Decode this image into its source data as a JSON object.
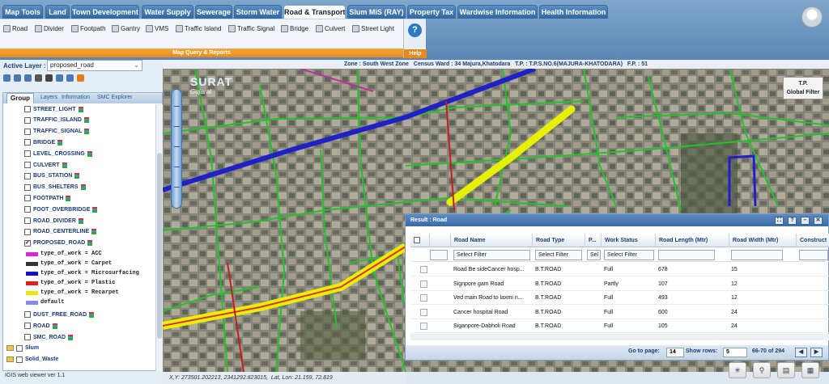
{
  "nav_tabs": [
    {
      "label": "Map Tools",
      "active": false
    },
    {
      "label": "Land",
      "active": false
    },
    {
      "label": "Town Development",
      "active": false
    },
    {
      "label": "Water Supply",
      "active": false
    },
    {
      "label": "Sewerage",
      "active": false
    },
    {
      "label": "Storm Water",
      "active": false
    },
    {
      "label": "Road & Transport",
      "active": true
    },
    {
      "label": "Slum MIS (RAY)",
      "active": false
    },
    {
      "label": "Property Tax",
      "active": false
    },
    {
      "label": "Wardwise Information",
      "active": false
    },
    {
      "label": "Health Information",
      "active": false
    }
  ],
  "ribbon": {
    "buttons": [
      {
        "label": "Road",
        "icon": "road-icon"
      },
      {
        "label": "Divider",
        "icon": "divider-icon"
      },
      {
        "label": "Footpath",
        "icon": "footpath-icon"
      },
      {
        "label": "Gantry",
        "icon": "gantry-icon"
      },
      {
        "label": "VMS",
        "icon": "vms-icon"
      },
      {
        "label": "Traffic Island",
        "icon": "traffic-island-icon"
      },
      {
        "label": "Traffic Signal",
        "icon": "traffic-signal-icon"
      },
      {
        "label": "Bridge",
        "icon": "bridge-icon"
      },
      {
        "label": "Culvert",
        "icon": "culvert-icon"
      },
      {
        "label": "Street Light",
        "icon": "street-light-icon"
      }
    ],
    "group_label": "Map Query & Reports",
    "help_label": "Help",
    "help_glyph": "?"
  },
  "active_layer": {
    "label": "Active Layer :",
    "value": "proposed_road"
  },
  "panel": {
    "tabs": [
      "Group",
      "Layers",
      "Information",
      "SMC Explorer"
    ],
    "layers": [
      {
        "name": "STREET_LIGHT",
        "checked": false
      },
      {
        "name": "TRAFFIC_ISLAND",
        "checked": false
      },
      {
        "name": "TRAFFIC_SIGNAL",
        "checked": false
      },
      {
        "name": "BRIDGE",
        "checked": false
      },
      {
        "name": "LEVEL_CROSSING",
        "checked": false
      },
      {
        "name": "CULVERT",
        "checked": false
      },
      {
        "name": "BUS_STATION",
        "checked": false
      },
      {
        "name": "BUS_SHELTERS",
        "checked": false
      },
      {
        "name": "FOOTPATH",
        "checked": false
      },
      {
        "name": "FOOT_OVERBRIDGE",
        "checked": false
      },
      {
        "name": "ROAD_DIVIDER",
        "checked": false
      },
      {
        "name": "ROAD_CENTERLINE",
        "checked": false
      },
      {
        "name": "PROPOSED_ROAD",
        "checked": true
      }
    ],
    "legend": [
      {
        "label": "type_of_work = ACC",
        "color": "#e020e0"
      },
      {
        "label": "type_of_work = Carpet",
        "color": "#333333"
      },
      {
        "label": "type_of_work = Microsurfacing",
        "color": "#1010c8"
      },
      {
        "label": "type_of_work = Plastic",
        "color": "#e02020"
      },
      {
        "label": "type_of_work = Recarpet",
        "color": "#e8e800"
      },
      {
        "label": "default",
        "color": "#8888ee"
      }
    ],
    "layers_after": [
      {
        "name": "DUST_FREE_ROAD",
        "checked": false
      },
      {
        "name": "ROAD",
        "checked": false
      },
      {
        "name": "SMC_ROAD",
        "checked": false
      }
    ],
    "groups": [
      {
        "name": "Slum"
      },
      {
        "name": "Solid_Waste"
      }
    ]
  },
  "version": "IGIS web viewer ver 1.1",
  "info_bar": {
    "zone": "Zone : South West Zone",
    "ward": "Census Ward : 34 Majura,Khatodara",
    "tp": "T.P. : T.P.S.NO.6(MAJURA-KHATODARA)",
    "fp": "F.P. : 51"
  },
  "map": {
    "logo_title": "SURAT",
    "logo_sub": "Gujarat",
    "filter_title": "T.P.",
    "filter_sub": "Global Filter"
  },
  "status": {
    "xy": "X,Y: 273501.202213, 2341292.823015",
    "latlon": "Lat, Lon: 21.159, 72.819"
  },
  "result": {
    "title": "Result : Road",
    "columns": [
      "Road Name",
      "Road Type",
      "P...",
      "Work Status",
      "Road Length (Mtr)",
      "Road Width (Mtr)",
      "Construct"
    ],
    "filter_placeholder": "Select Filter",
    "filter_short": "Sel",
    "rows": [
      [
        "Road Be sideCancer hosp...",
        "B.T.ROAD",
        "",
        "Full",
        "678",
        "15"
      ],
      [
        "Signpore gam Road",
        "B.T.ROAD",
        "",
        "Partly",
        "107",
        "12"
      ],
      [
        "Ved main Road to laxmi n...",
        "B.T.ROAD",
        "",
        "Full",
        "493",
        "12"
      ],
      [
        "Cancer hospital Road",
        "B.T.ROAD",
        "",
        "Full",
        "600",
        "24"
      ],
      [
        "Siganpore-Dabholi Road",
        "B.T.ROAD",
        "",
        "Full",
        "105",
        "24"
      ]
    ],
    "pager": {
      "goto_label": "Go to page:",
      "page": "14",
      "rows_label": "Show rows:",
      "rows": "5",
      "range": "66-70 of 294"
    }
  },
  "bottom_tools": [
    "zoom-extent-icon",
    "magnifier-icon",
    "print-icon",
    "layers-settings-icon"
  ]
}
